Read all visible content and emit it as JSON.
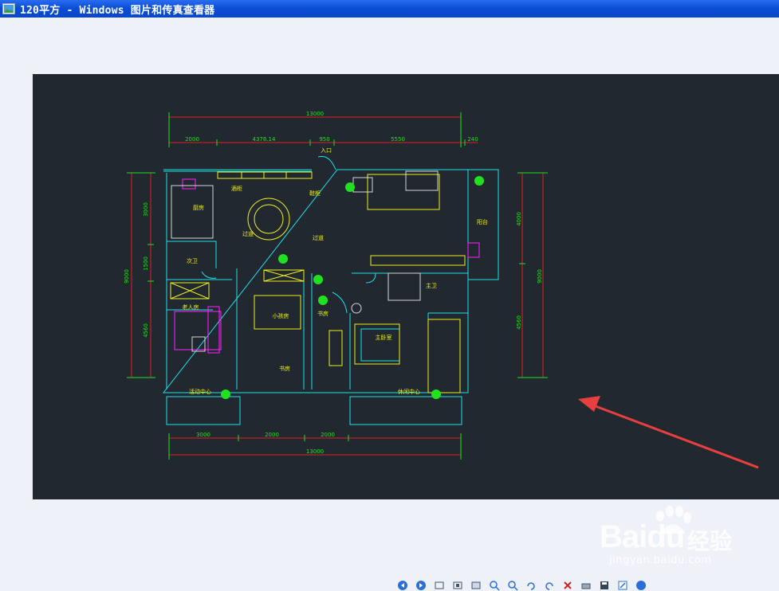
{
  "window": {
    "title": "120平方 - Windows 图片和传真查看器"
  },
  "colors": {
    "titlebar": "#0a4fd6",
    "canvas_bg": "#212830",
    "cad_cyan": "#20e0e8",
    "cad_yellow": "#f0f020",
    "cad_green": "#20e020",
    "cad_red": "#e02020",
    "cad_magenta": "#ff20ff",
    "arrow": "#e84040"
  },
  "plan": {
    "dims_top": {
      "total": "13000",
      "seg1": "2000",
      "seg2": "4378.14",
      "seg3": "950",
      "seg4": "5550",
      "seg5": "240"
    },
    "dims_bottom": {
      "seg1": "3000",
      "seg2": "2000",
      "seg3": "2000",
      "total": "13000"
    },
    "dims_left": {
      "total": "9000",
      "seg1": "3000",
      "seg2": "1500",
      "seg3": "4560"
    },
    "dims_right": {
      "total": "9000",
      "seg1": "4000",
      "seg2": "4560"
    },
    "rooms": {
      "entrance": "入口",
      "kitchen": "厨房",
      "cabinet": "酒柜",
      "shoe_cabinet": "鞋柜",
      "aisle1": "过道",
      "aisle2": "过道",
      "second_bath": "次卫",
      "elder_room": "老人房",
      "kids_room": "小孩房",
      "study1": "书房",
      "study2": "书房",
      "master_bath": "主卫",
      "master_bed": "主卧室",
      "balcony": "阳台",
      "activity": "活动中心",
      "leisure": "休闲中心"
    }
  },
  "watermark": {
    "brand": "Baidu",
    "cn": "经验",
    "url": "jingyan.baidu.com"
  },
  "toolbar": {
    "icons": [
      "previous-icon",
      "next-icon",
      "best-fit-icon",
      "actual-size-icon",
      "slideshow-icon",
      "zoom-in-icon",
      "zoom-out-icon",
      "rotate-clockwise-icon",
      "rotate-counterclockwise-icon",
      "delete-icon",
      "print-icon",
      "save-icon",
      "edit-icon",
      "help-icon"
    ]
  }
}
